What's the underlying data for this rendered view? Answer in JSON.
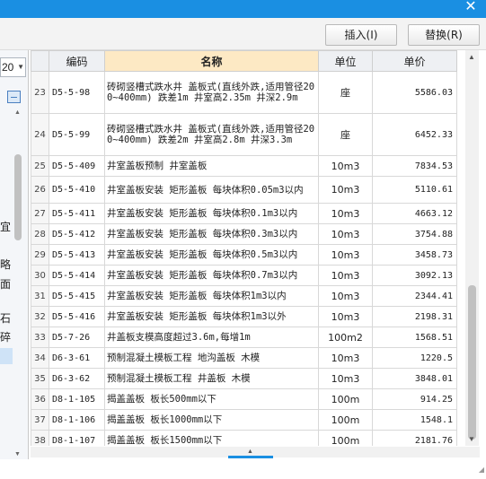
{
  "window": {
    "close_icon": "close-icon"
  },
  "toolbar": {
    "insert_label": "插入(I)",
    "replace_label": "替换(R)"
  },
  "left_pane": {
    "combo_value": "20",
    "chars": [
      "宜",
      "略",
      "面",
      "石",
      "碎"
    ]
  },
  "table": {
    "headers": {
      "index": "",
      "code": "编码",
      "name": "名称",
      "unit": "单位",
      "price": "单价"
    },
    "rows": [
      {
        "idx": "23",
        "code": "D5-5-98",
        "name": "砖砌竖槽式跌水井 盖板式(直线外跌,适用管径200~400mm) 跌差1m 井室高2.35m 井深2.9m",
        "unit": "座",
        "price": "5586.03"
      },
      {
        "idx": "24",
        "code": "D5-5-99",
        "name": "砖砌竖槽式跌水井 盖板式(直线外跌,适用管径200~400mm) 跌差2m 井室高2.8m 井深3.3m",
        "unit": "座",
        "price": "6452.33"
      },
      {
        "idx": "25",
        "code": "D5-5-409",
        "name": "井室盖板预制 井室盖板",
        "unit": "10m3",
        "price": "7834.53"
      },
      {
        "idx": "26",
        "code": "D5-5-410",
        "name": "井室盖板安装 矩形盖板 每块体积0.05m3以内",
        "unit": "10m3",
        "price": "5110.61"
      },
      {
        "idx": "27",
        "code": "D5-5-411",
        "name": "井室盖板安装 矩形盖板 每块体积0.1m3以内",
        "unit": "10m3",
        "price": "4663.12"
      },
      {
        "idx": "28",
        "code": "D5-5-412",
        "name": "井室盖板安装 矩形盖板 每块体积0.3m3以内",
        "unit": "10m3",
        "price": "3754.88"
      },
      {
        "idx": "29",
        "code": "D5-5-413",
        "name": "井室盖板安装 矩形盖板 每块体积0.5m3以内",
        "unit": "10m3",
        "price": "3458.73"
      },
      {
        "idx": "30",
        "code": "D5-5-414",
        "name": "井室盖板安装 矩形盖板 每块体积0.7m3以内",
        "unit": "10m3",
        "price": "3092.13"
      },
      {
        "idx": "31",
        "code": "D5-5-415",
        "name": "井室盖板安装 矩形盖板 每块体积1m3以内",
        "unit": "10m3",
        "price": "2344.41"
      },
      {
        "idx": "32",
        "code": "D5-5-416",
        "name": "井室盖板安装 矩形盖板 每块体积1m3以外",
        "unit": "10m3",
        "price": "2198.31"
      },
      {
        "idx": "33",
        "code": "D5-7-26",
        "name": "井盖板支模高度超过3.6m,每增1m",
        "unit": "100m2",
        "price": "1568.51"
      },
      {
        "idx": "34",
        "code": "D6-3-61",
        "name": "预制混凝土模板工程 地沟盖板 木模",
        "unit": "10m3",
        "price": "1220.5"
      },
      {
        "idx": "35",
        "code": "D6-3-62",
        "name": "预制混凝土模板工程 井盖板 木模",
        "unit": "10m3",
        "price": "3848.01"
      },
      {
        "idx": "36",
        "code": "D8-1-105",
        "name": "揭盖盖板 板长500mm以下",
        "unit": "100m",
        "price": "914.25"
      },
      {
        "idx": "37",
        "code": "D8-1-106",
        "name": "揭盖盖板 板长1000mm以下",
        "unit": "100m",
        "price": "1548.1"
      },
      {
        "idx": "38",
        "code": "D8-1-107",
        "name": "揭盖盖板 板长1500mm以下",
        "unit": "100m",
        "price": "2181.76"
      }
    ]
  },
  "colors": {
    "titlebar": "#1a8fe2",
    "header_highlight": "#fde9c4"
  }
}
